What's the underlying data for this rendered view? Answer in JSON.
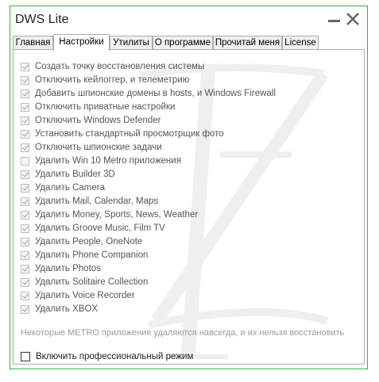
{
  "window": {
    "title": "DWS Lite"
  },
  "tabs": [
    {
      "label": "Главная",
      "active": false
    },
    {
      "label": "Настройки",
      "active": true
    },
    {
      "label": "Утилиты",
      "active": false
    },
    {
      "label": "О программе",
      "active": false
    },
    {
      "label": "Прочитай меня",
      "active": false
    },
    {
      "label": "License",
      "active": false
    }
  ],
  "settings": {
    "options": [
      {
        "label": "Создать точку восстановления системы",
        "checked": true
      },
      {
        "label": "Отключить кейлоггер, и телеметрию",
        "checked": true
      },
      {
        "label": "Добавить шпионские домены в hosts, и Windows Firewall",
        "checked": true
      },
      {
        "label": "Отключить приватные настройки",
        "checked": true
      },
      {
        "label": "Отключить Windows Defender",
        "checked": true
      },
      {
        "label": "Установить стандартный просмотрщик фото",
        "checked": true
      },
      {
        "label": "Отключить шпионские задачи",
        "checked": true
      },
      {
        "label": "Удалить Win 10 Metro приложения",
        "checked": false
      },
      {
        "label": "Удалить Builder 3D",
        "checked": true
      },
      {
        "label": "Удалить Camera",
        "checked": true
      },
      {
        "label": "Удалить Mail, Calendar, Maps",
        "checked": true
      },
      {
        "label": "Удалить Money, Sports, News, Weather",
        "checked": true
      },
      {
        "label": "Удалить Groove Music, Film TV",
        "checked": true
      },
      {
        "label": "Удалить People, OneNote",
        "checked": true
      },
      {
        "label": "Удалить Phone Companion",
        "checked": true
      },
      {
        "label": "Удалить Photos",
        "checked": true
      },
      {
        "label": "Удалить Solitaire Collection",
        "checked": true
      },
      {
        "label": "Удалить Voice Recorder",
        "checked": true
      },
      {
        "label": "Удалить XBOX",
        "checked": true
      }
    ],
    "note": "Некоторые METRO приложения удаляются навсегда, и их нельзя восстановить",
    "pro_mode": {
      "label": "Включить профессиональный режим",
      "checked": false
    }
  },
  "colors": {
    "window_border": "#3cb043",
    "watermark": "#8c8c8c"
  },
  "icons": {
    "minimize": "minimize-icon",
    "close": "close-icon",
    "checkbox_checked": "check-icon"
  }
}
